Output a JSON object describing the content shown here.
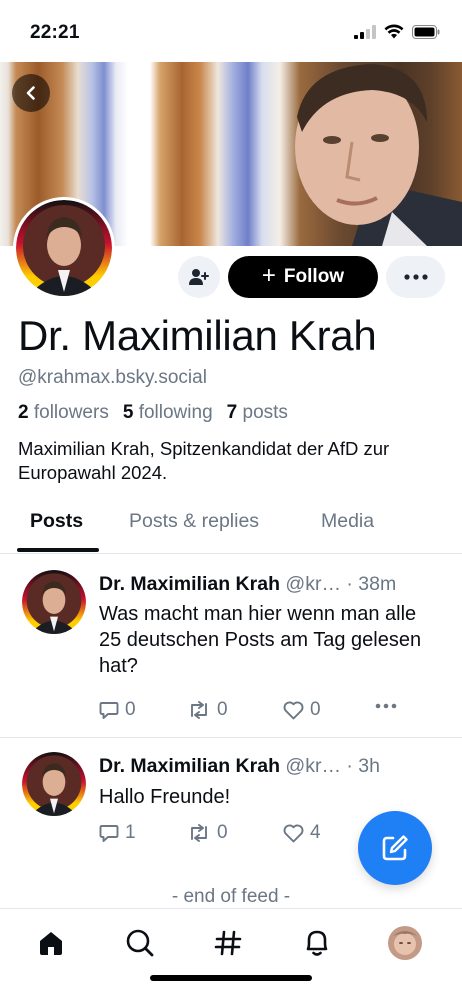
{
  "status_bar": {
    "time": "22:21",
    "icons": [
      "signal-icon",
      "wifi-icon",
      "battery-icon"
    ]
  },
  "profile": {
    "display_name": "Dr. Maximilian Krah",
    "handle": "@krahmax.bsky.social",
    "stats": {
      "followers_count": "2",
      "followers_label": "followers",
      "following_count": "5",
      "following_label": "following",
      "posts_count": "7",
      "posts_label": "posts"
    },
    "bio": "Maximilian Krah, Spitzenkandidat der AfD zur Europawahl 2024.",
    "follow_label": "Follow"
  },
  "tabs": [
    {
      "label": "Posts",
      "active": true
    },
    {
      "label": "Posts & replies",
      "active": false
    },
    {
      "label": "Media",
      "active": false
    }
  ],
  "posts": [
    {
      "author": "Dr. Maximilian Krah",
      "handle_truncated": "@kr…",
      "time": "· 38m",
      "text": "Was macht man hier wenn man alle 25 deutschen Posts am Tag gelesen hat?",
      "replies": "0",
      "reposts": "0",
      "likes": "0"
    },
    {
      "author": "Dr. Maximilian Krah",
      "handle_truncated": "@kr…",
      "time": "· 3h",
      "text": "Hallo Freunde!",
      "replies": "1",
      "reposts": "0",
      "likes": "4"
    }
  ],
  "end_of_feed": "- end of feed -",
  "colors": {
    "accent": "#1f7ff5",
    "text": "#0b0f14",
    "muted": "#6b7785",
    "button_bg": "#eef1f5"
  },
  "nav": [
    "home-icon",
    "search-icon",
    "hashtag-icon",
    "bell-icon",
    "profile-avatar"
  ]
}
